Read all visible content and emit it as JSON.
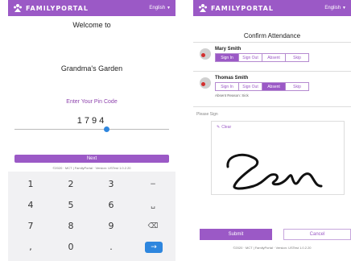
{
  "brand": {
    "name": "FAMILYPORTAL",
    "language": "English"
  },
  "colors": {
    "primary": "#9b59c6",
    "accent": "#2e86de",
    "alert": "#d32f2f"
  },
  "pin_screen": {
    "welcome": "Welcome to",
    "place": "Grandma's Garden",
    "pin_label": "Enter Your Pin Code",
    "pin_value": "1794",
    "next_label": "Next",
    "footer": "©2020 · MCT | FamilyPortal · Version: USTest 1.0.2.20",
    "keys": [
      "1",
      "2",
      "3",
      "−",
      "4",
      "5",
      "6",
      "␣",
      "7",
      "8",
      "9",
      "⌫",
      ",",
      "0",
      ".",
      "→"
    ]
  },
  "attendance": {
    "title": "Confirm Attendance",
    "language": "English",
    "status_labels": [
      "Sign In",
      "Sign Out",
      "Absent",
      "Skip"
    ],
    "people": [
      {
        "name": "Mary Smith",
        "selected": "Sign In",
        "reason": ""
      },
      {
        "name": "Thomas Smith",
        "selected": "Absent",
        "reason": "Absent Reason: Sick"
      }
    ],
    "please_sign": "Please Sign",
    "clear_label": "Clear",
    "submit_label": "Submit",
    "cancel_label": "Cancel",
    "footer": "©2020 · MCT | FamilyPortal · Version: USTest 1.0.2.20"
  }
}
